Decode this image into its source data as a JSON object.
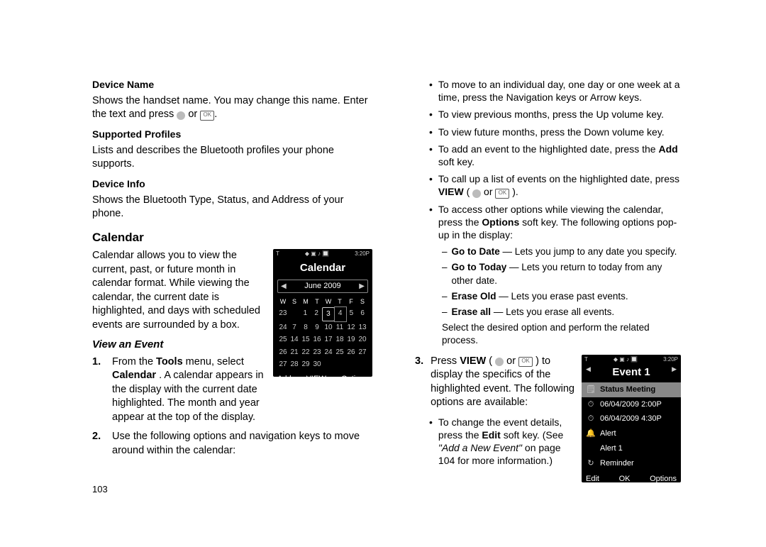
{
  "left": {
    "deviceName": {
      "h": "Device Name",
      "p": "Shows the handset name. You may change this name. Enter the text and press ",
      "or": " or "
    },
    "supportedProfiles": {
      "h": "Supported Profiles",
      "p": "Lists and describes the Bluetooth profiles your phone supports."
    },
    "deviceInfo": {
      "h": "Device Info",
      "p": "Shows the Bluetooth Type, Status, and Address of your phone."
    },
    "calendar": {
      "h": "Calendar",
      "p": "Calendar allows you to view the current, past, or future month in calendar format. While viewing the calendar, the current date is highlighted, and days with scheduled events are surrounded by a box."
    },
    "viewEvent": {
      "h": "View an Event",
      "li1a": "From the ",
      "li1b": "Tools",
      "li1c": " menu, select ",
      "li1d": "Calendar",
      "li1e": ". A calendar appears in the display with the current date highlighted. The month and year appear at the top of the display.",
      "li2": "Use the following options and navigation keys to move around within the calendar:"
    },
    "calPhone": {
      "statusLeft": "T",
      "statusRight": "3:20P",
      "title": "Calendar",
      "month": "June 2009",
      "dow": [
        "W",
        "S",
        "M",
        "T",
        "W",
        "T",
        "F",
        "S"
      ],
      "rows": [
        [
          "23",
          "",
          "1",
          "2",
          "3",
          "4",
          "5",
          "6"
        ],
        [
          "24",
          "7",
          "8",
          "9",
          "10",
          "11",
          "12",
          "13"
        ],
        [
          "25",
          "14",
          "15",
          "16",
          "17",
          "18",
          "19",
          "20"
        ],
        [
          "26",
          "21",
          "22",
          "23",
          "24",
          "25",
          "26",
          "27"
        ],
        [
          "27",
          "28",
          "29",
          "30",
          "",
          "",
          "",
          ""
        ]
      ],
      "softLeft": "Add",
      "softMid": "VIEW",
      "softRight": "Options"
    },
    "pageNum": "103"
  },
  "right": {
    "b1": "To move to an individual day, one day or one week at a time, press the Navigation keys or Arrow keys.",
    "b2": "To view previous months, press the Up volume key.",
    "b3": "To view future months, press the Down volume key.",
    "b4a": "To add an event to the highlighted date, press the ",
    "b4b": "Add",
    "b4c": " soft key.",
    "b5a": "To call up a list of events on the highlighted date, press ",
    "b5b": "VIEW",
    "b5c": " ( ",
    "b5_or": " or ",
    "b5d": " ).",
    "b6a": "To access other options while viewing the calendar, press the ",
    "b6b": "Options",
    "b6c": " soft key. The following options pop-up in the display:",
    "d1a": "Go to Date",
    "d1b": " — Lets you jump to any date you specify.",
    "d2a": "Go to Today",
    "d2b": " — Lets you return to today from any other date.",
    "d3a": "Erase Old",
    "d3b": " — Lets you erase past events.",
    "d4a": "Erase all",
    "d4b": " — Lets you erase all events.",
    "sel": "Select the desired option and perform the related process.",
    "step3_a": "Press ",
    "step3_b": "VIEW",
    "step3_c": " ( ",
    "step3_or": " or ",
    "step3_d": " ) to display the specifics of the highlighted event. The following options are available:",
    "b7a": "To change the event details, press the ",
    "b7b": "Edit",
    "b7c": " soft key. (See ",
    "b7d": "\"Add a New Event\"",
    "b7e": " on page 104 for more information.)",
    "evPhone": {
      "statusLeft": "T",
      "statusRight": "3:20P",
      "title": "Event 1",
      "rows": [
        {
          "ico": "🗒",
          "lbl": "Status Meeting",
          "sel": true
        },
        {
          "ico": "⏱",
          "lbl": "06/04/2009 2:00P"
        },
        {
          "ico": "⏱",
          "lbl": "06/04/2009 4:30P"
        },
        {
          "ico": "🔔",
          "lbl": "Alert"
        },
        {
          "ico": "",
          "lbl": "Alert 1"
        },
        {
          "ico": "↻",
          "lbl": "Reminder"
        }
      ],
      "softLeft": "Edit",
      "softMid": "OK",
      "softRight": "Options"
    }
  }
}
